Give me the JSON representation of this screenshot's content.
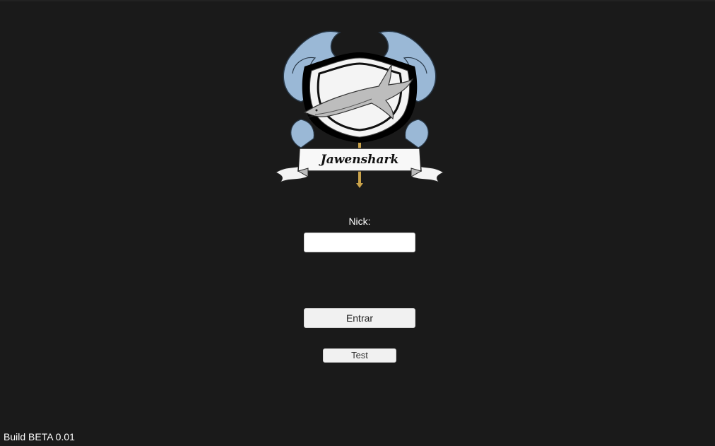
{
  "logo": {
    "text": "Jawenshark"
  },
  "login": {
    "nick_label": "Nick:",
    "nick_value": "",
    "enter_label": "Entrar",
    "test_label": "Test"
  },
  "footer": {
    "build": "Build BETA 0.01"
  },
  "colors": {
    "background": "#1a1a1a",
    "wave_blue": "#9ab8d6",
    "button_bg": "#f1f1f1",
    "label_text": "#ffffff"
  }
}
